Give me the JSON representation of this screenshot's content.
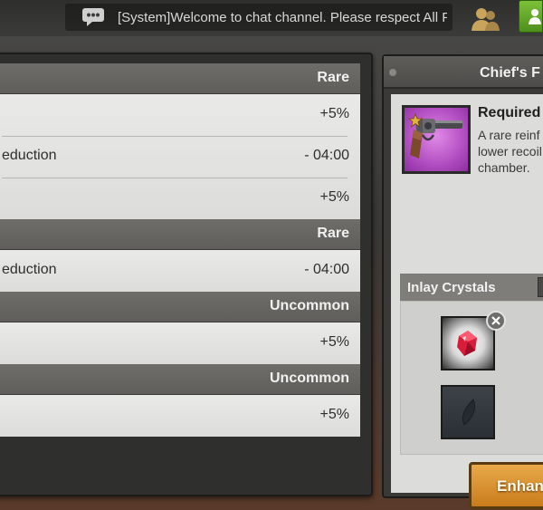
{
  "chat": {
    "icon": "chat-bubble-icon",
    "message": "[System]Welcome to chat channel. Please respect All Pl.."
  },
  "top_icons": {
    "friends": "friends-icon",
    "green_button": "person-icon"
  },
  "attributes": {
    "groups": [
      {
        "rarity": "Rare",
        "rows": [
          {
            "name": "",
            "value": "+5%"
          },
          {
            "name": "eduction",
            "value": "- 04:00"
          },
          {
            "name": "",
            "value": "+5%"
          }
        ]
      },
      {
        "rarity": "Rare",
        "rows": [
          {
            "name": "eduction",
            "value": "- 04:00"
          }
        ]
      },
      {
        "rarity": "Uncommon",
        "rows": [
          {
            "name": "",
            "value": "+5%"
          }
        ]
      },
      {
        "rarity": "Uncommon",
        "rows": [
          {
            "name": "",
            "value": "+5%"
          }
        ]
      }
    ]
  },
  "detail": {
    "title": "Chief's F",
    "item_icon": "revolver-icon",
    "item_rarity_color": "#c060d0",
    "required_label": "Required",
    "description_lines": [
      "A rare reinf",
      "lower recoil",
      "chamber."
    ],
    "inlay_label": "Inlay Crystals",
    "slots": [
      {
        "state": "filled",
        "icon": "ruby-crystal-icon"
      },
      {
        "state": "empty",
        "icon": "empty-slot-icon"
      }
    ],
    "remove_icon": "close-icon",
    "enhance_label": "Enhan"
  }
}
